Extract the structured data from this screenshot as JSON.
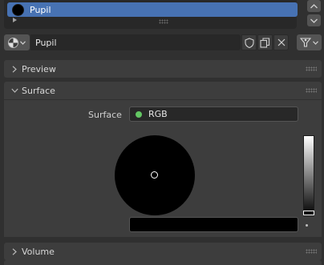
{
  "slots": {
    "items": [
      {
        "label": "Pupil",
        "selected": true,
        "swatch_color": "#000000"
      }
    ]
  },
  "material": {
    "name": "Pupil"
  },
  "panels": {
    "preview": {
      "title": "Preview",
      "expanded": false
    },
    "surface": {
      "title": "Surface",
      "expanded": true,
      "field_label": "Surface",
      "field_value": "RGB",
      "socket_color": "#63c763",
      "color_value_level": 0.0,
      "color_hex": "#000000"
    },
    "volume": {
      "title": "Volume",
      "expanded": false
    }
  },
  "colors": {
    "accent": "#4772b3",
    "panel": "#3d3d3d",
    "background": "#303030"
  }
}
